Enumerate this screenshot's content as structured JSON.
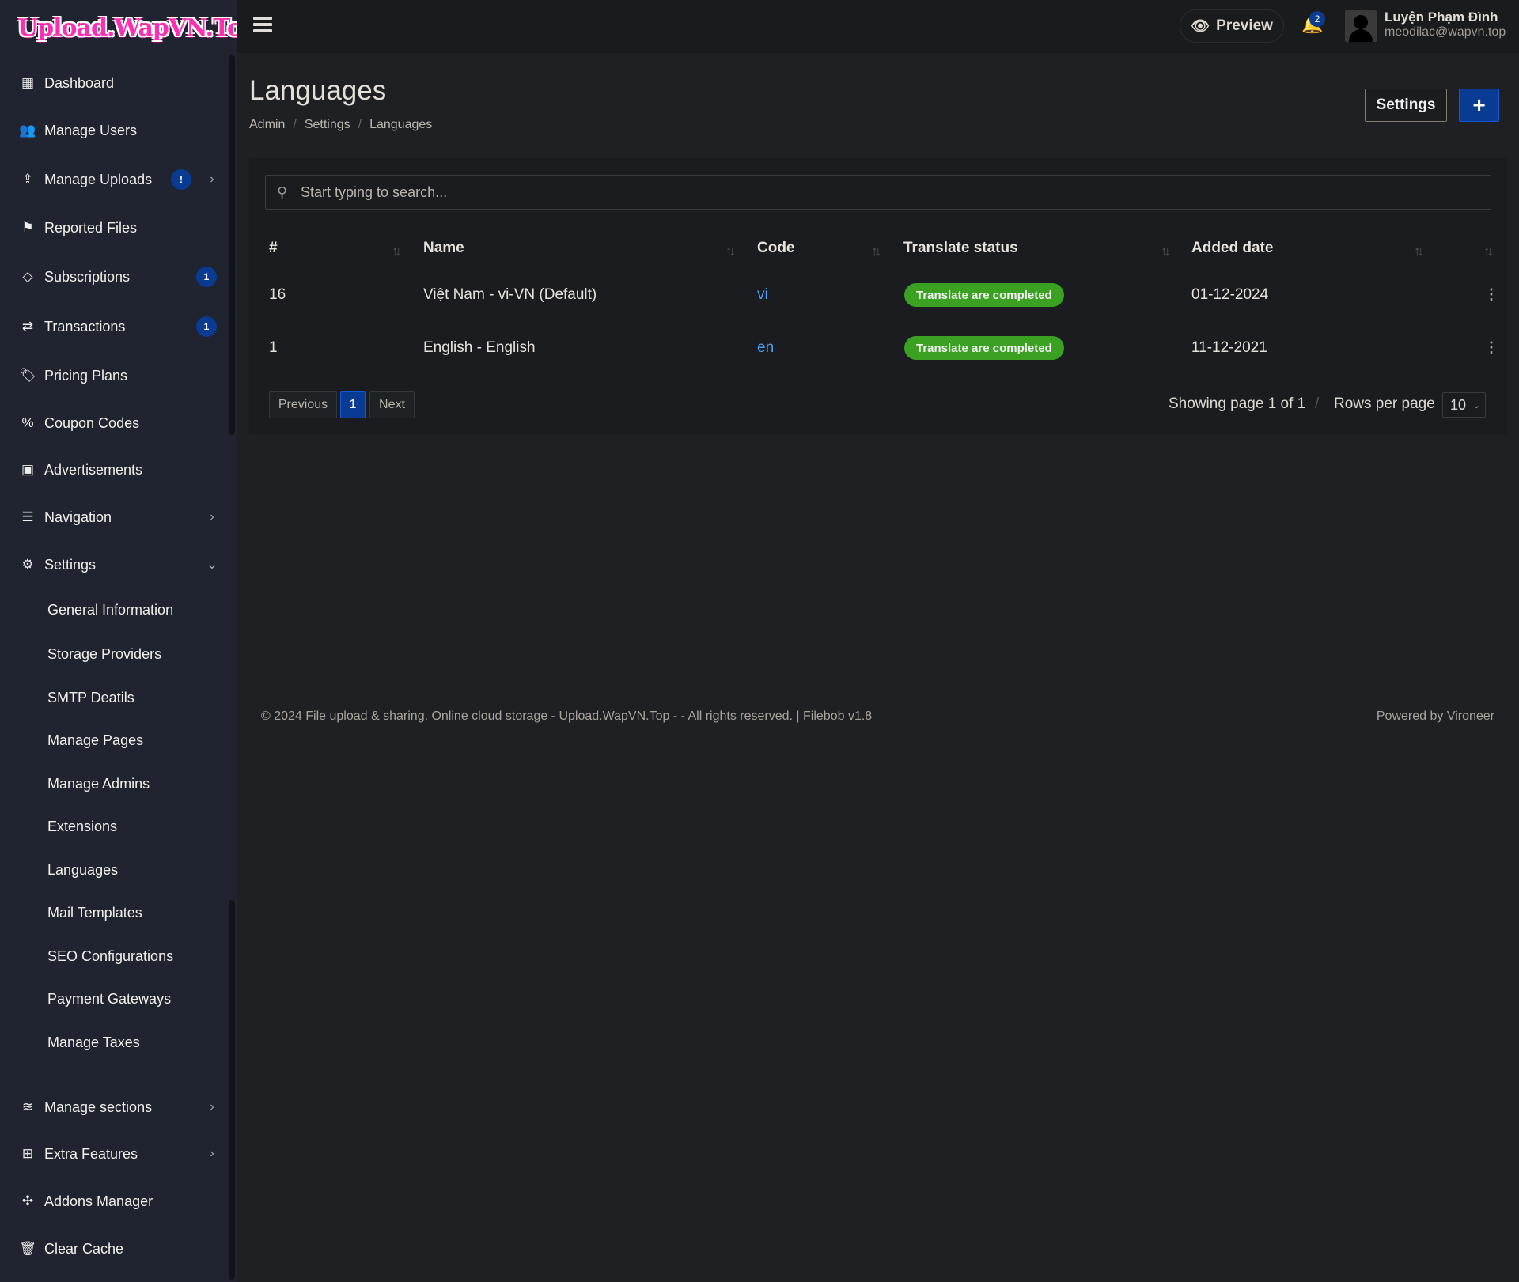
{
  "brand": {
    "logo_text": "Upload.WapVN.Top"
  },
  "sidebar": {
    "items": [
      {
        "label": "Dashboard",
        "icon": "dashboard-icon",
        "glyph": "▦"
      },
      {
        "label": "Manage Users",
        "icon": "users-icon",
        "glyph": "👥"
      },
      {
        "label": "Manage Uploads",
        "icon": "upload-icon",
        "glyph": "⇪",
        "badge": "!",
        "chevron": "›"
      },
      {
        "label": "Reported Files",
        "icon": "flag-icon",
        "glyph": "⚑"
      },
      {
        "label": "Subscriptions",
        "icon": "gem-icon",
        "glyph": "◇",
        "badge": "1"
      },
      {
        "label": "Transactions",
        "icon": "exchange-icon",
        "glyph": "⇄",
        "badge": "1"
      },
      {
        "label": "Pricing Plans",
        "icon": "tags-icon",
        "glyph": "🏷"
      },
      {
        "label": "Coupon Codes",
        "icon": "percent-icon",
        "glyph": "%"
      },
      {
        "label": "Advertisements",
        "icon": "ad-icon",
        "glyph": "▣"
      },
      {
        "label": "Navigation",
        "icon": "bars-icon",
        "glyph": "☰",
        "chevron": "›"
      },
      {
        "label": "Settings",
        "icon": "gear-icon",
        "glyph": "⚙",
        "chevron": "⌄"
      },
      {
        "label": "General Information",
        "sub": true
      },
      {
        "label": "Storage Providers",
        "sub": true
      },
      {
        "label": "SMTP Deatils",
        "sub": true
      },
      {
        "label": "Manage Pages",
        "sub": true
      },
      {
        "label": "Manage Admins",
        "sub": true
      },
      {
        "label": "Extensions",
        "sub": true
      },
      {
        "label": "Languages",
        "sub": true,
        "active": true
      },
      {
        "label": "Mail Templates",
        "sub": true
      },
      {
        "label": "SEO Configurations",
        "sub": true
      },
      {
        "label": "Payment Gateways",
        "sub": true
      },
      {
        "label": "Manage Taxes",
        "sub": true
      },
      {
        "label": "Manage sections",
        "icon": "layers-icon",
        "glyph": "≋",
        "chevron": "›"
      },
      {
        "label": "Extra Features",
        "icon": "plus-square-icon",
        "glyph": "⊞",
        "chevron": "›"
      },
      {
        "label": "Addons Manager",
        "icon": "puzzle-icon",
        "glyph": "✣"
      },
      {
        "label": "Clear Cache",
        "icon": "trash-icon",
        "glyph": "🗑"
      }
    ]
  },
  "topbar": {
    "preview_label": "Preview",
    "notifications_count": "2",
    "user_name": "Luyện Phạm Đình",
    "user_email": "meodilac@wapvn.top"
  },
  "page": {
    "title": "Languages",
    "breadcrumb": [
      "Admin",
      "Settings",
      "Languages"
    ],
    "settings_button": "Settings",
    "add_button": "+"
  },
  "search": {
    "placeholder": "Start typing to search..."
  },
  "table": {
    "headers": [
      "#",
      "Name",
      "Code",
      "Translate status",
      "Added date"
    ],
    "rows": [
      {
        "id": "16",
        "name": "Việt Nam - vi-VN (Default)",
        "code": "vi",
        "status": "Translate are completed",
        "date": "01-12-2024"
      },
      {
        "id": "1",
        "name": "English - English",
        "code": "en",
        "status": "Translate are completed",
        "date": "11-12-2021"
      }
    ]
  },
  "pagination": {
    "previous": "Previous",
    "current": "1",
    "next": "Next",
    "info": "Showing page 1 of 1",
    "separator": "/",
    "rows_label": "Rows per page",
    "rows_value": "10"
  },
  "footer": {
    "copyright": "© 2024 File upload & sharing. Online cloud storage - Upload.WapVN.Top - - All rights reserved. | Filebob v1.8",
    "powered": "Powered by Vironeer"
  },
  "colors": {
    "accent": "#083b91",
    "success": "#3aa122",
    "link": "#4a9df5",
    "sidebar_bg": "#1f2430"
  }
}
